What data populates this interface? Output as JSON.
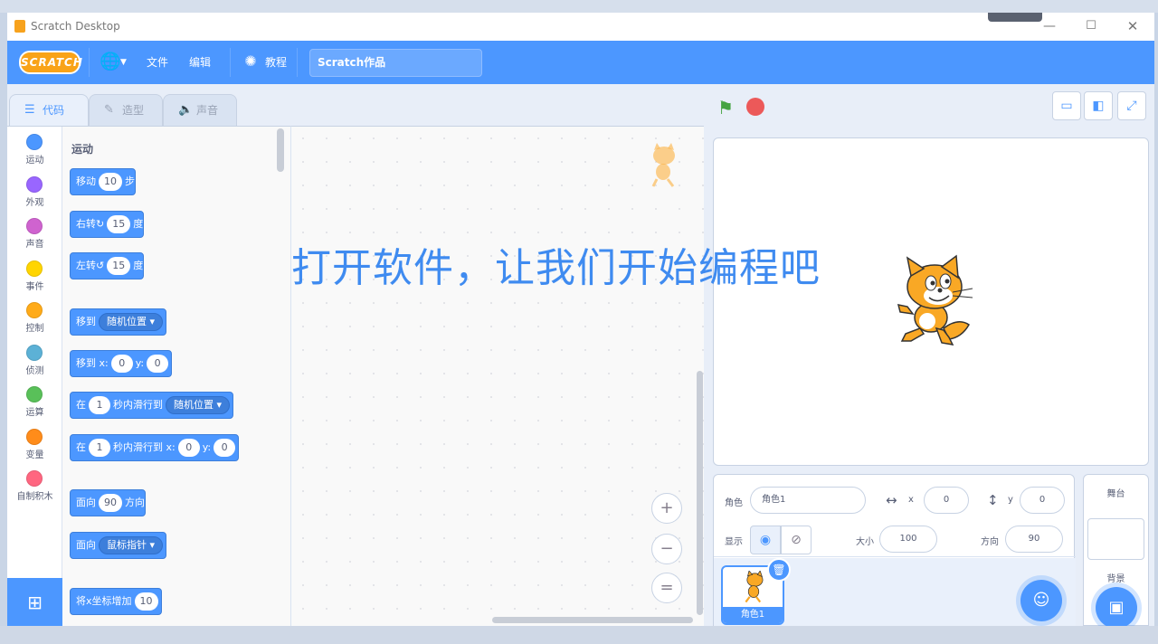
{
  "window": {
    "title": "Scratch Desktop",
    "minimize": "—",
    "maximize": "☐",
    "close": "✕"
  },
  "menu": {
    "logo": "SCRATCH",
    "language_icon": "globe-icon",
    "file": "文件",
    "edit": "编辑",
    "tutorials": "教程",
    "project_title": "Scratch作品"
  },
  "tabs": [
    {
      "label": "代码",
      "icon": "code-icon"
    },
    {
      "label": "造型",
      "icon": "brush-icon"
    },
    {
      "label": "声音",
      "icon": "speaker-icon"
    }
  ],
  "categories": [
    {
      "label": "运动",
      "color": "#4c97ff"
    },
    {
      "label": "外观",
      "color": "#9966ff"
    },
    {
      "label": "声音",
      "color": "#cf63cf"
    },
    {
      "label": "事件",
      "color": "#ffd500"
    },
    {
      "label": "控制",
      "color": "#ffab19"
    },
    {
      "label": "侦测",
      "color": "#5cb1d6"
    },
    {
      "label": "运算",
      "color": "#59c059"
    },
    {
      "label": "变量",
      "color": "#ff8c1a"
    },
    {
      "label": "自制积木",
      "color": "#ff6680"
    }
  ],
  "palette": {
    "heading": "运动",
    "blocks": [
      {
        "pre": "移动",
        "val": "10",
        "post": "步"
      },
      {
        "pre": "右转",
        "icon": "↻",
        "val": "15",
        "post": "度"
      },
      {
        "pre": "左转",
        "icon": "↺",
        "val": "15",
        "post": "度"
      },
      {
        "pre": "移到",
        "drop": "随机位置"
      },
      {
        "pre": "移到 x:",
        "x": "0",
        "mid": "y:",
        "y": "0"
      },
      {
        "pre": "在",
        "val": "1",
        "post": "秒内滑行到",
        "drop": "随机位置"
      },
      {
        "pre": "在",
        "val": "1",
        "post": "秒内滑行到 x:",
        "x": "0",
        "mid": "y:",
        "y": "0"
      },
      {
        "pre": "面向",
        "val": "90",
        "post": "方向"
      },
      {
        "pre": "面向",
        "drop": "鼠标指针"
      },
      {
        "pre": "将x坐标增加",
        "val": "10"
      }
    ]
  },
  "zoom": {
    "in": "+",
    "out": "−",
    "reset": "="
  },
  "stage_controls": {
    "flag_icon": "green-flag-icon",
    "stop_icon": "stop-icon"
  },
  "sprite_info": {
    "sprite_label": "角色",
    "sprite_name": "角色1",
    "x_label": "x",
    "x": "0",
    "y_label": "y",
    "y": "0",
    "show_label": "显示",
    "size_label": "大小",
    "size": "100",
    "direction_label": "方向",
    "direction": "90"
  },
  "sprite_list": [
    {
      "name": "角色1"
    }
  ],
  "backdrop": {
    "stage_label": "舞台",
    "backdrop_label": "背景"
  },
  "overlay": "打开软件，让我们开始编程吧"
}
